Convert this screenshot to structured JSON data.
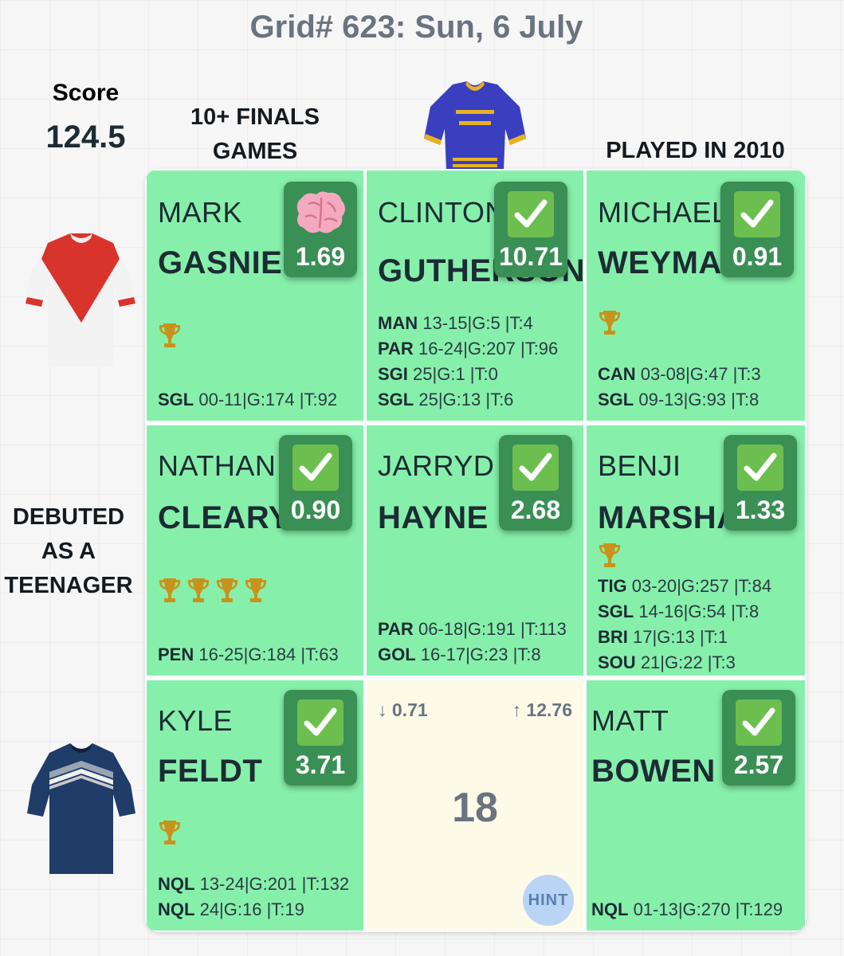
{
  "title": "Grid# 623: Sun, 6 July",
  "score": {
    "label": "Score",
    "value": "124.5"
  },
  "columns": [
    {
      "label_line1": "10+ FINALS",
      "label_line2": "GAMES"
    },
    {
      "jersey": "eels-jersey"
    },
    {
      "label_line1": "PLAYED IN 2010"
    }
  ],
  "rows": [
    {
      "jersey": "dragons-jersey"
    },
    {
      "label_line1": "DEBUTED",
      "label_line2": "AS A",
      "label_line3": "TEENAGER"
    },
    {
      "jersey": "cowboys-jersey"
    }
  ],
  "cells": {
    "r1c1": {
      "first": "MARK",
      "last": "GASNIER",
      "badge_icon": "brain-icon",
      "score": "1.69",
      "trophies": 1,
      "career": [
        {
          "team": "SGL",
          "detail": "00-11|G:174 |T:92"
        }
      ]
    },
    "r1c2": {
      "first": "CLINTON",
      "last": "GUTHERSON",
      "badge_icon": "check-icon",
      "score": "10.71",
      "trophies": 0,
      "career": [
        {
          "team": "MAN",
          "detail": "13-15|G:5 |T:4"
        },
        {
          "team": "PAR",
          "detail": "16-24|G:207 |T:96"
        },
        {
          "team": "SGI",
          "detail": "25|G:1 |T:0"
        },
        {
          "team": "SGL",
          "detail": "25|G:13 |T:6"
        }
      ]
    },
    "r1c3": {
      "first": "MICHAEL",
      "last": "WEYMAN",
      "badge_icon": "check-icon",
      "score": "0.91",
      "trophies": 1,
      "career": [
        {
          "team": "CAN",
          "detail": "03-08|G:47 |T:3"
        },
        {
          "team": "SGL",
          "detail": "09-13|G:93 |T:8"
        }
      ]
    },
    "r2c1": {
      "first": "NATHAN",
      "last": "CLEARY",
      "badge_icon": "check-icon",
      "score": "0.90",
      "trophies": 4,
      "career": [
        {
          "team": "PEN",
          "detail": "16-25|G:184 |T:63"
        }
      ]
    },
    "r2c2": {
      "first": "JARRYD",
      "last": "HAYNE",
      "badge_icon": "check-icon",
      "score": "2.68",
      "trophies": 0,
      "career": [
        {
          "team": "PAR",
          "detail": "06-18|G:191 |T:113"
        },
        {
          "team": "GOL",
          "detail": "16-17|G:23 |T:8"
        }
      ]
    },
    "r2c3": {
      "first": "BENJI",
      "last": "MARSHALL",
      "badge_icon": "check-icon",
      "score": "1.33",
      "trophies": 1,
      "career": [
        {
          "team": "TIG",
          "detail": "03-20|G:257 |T:84"
        },
        {
          "team": "SGL",
          "detail": "14-16|G:54 |T:8"
        },
        {
          "team": "BRI",
          "detail": "17|G:13 |T:1"
        },
        {
          "team": "SOU",
          "detail": "21|G:22 |T:3"
        }
      ]
    },
    "r3c1": {
      "first": "KYLE",
      "last": "FELDT",
      "badge_icon": "check-icon",
      "score": "3.71",
      "trophies": 1,
      "career": [
        {
          "team": "NQL",
          "detail": "13-24|G:201 |T:132"
        },
        {
          "team": "NQL",
          "detail": "24|G:16 |T:19"
        }
      ]
    },
    "r3c2": {
      "empty": true,
      "low": "↓ 0.71",
      "high": "↑ 12.76",
      "count": "18",
      "hint": "HINT"
    },
    "r3c3": {
      "first": "MATT",
      "last": "BOWEN",
      "badge_icon": "check-icon",
      "score": "2.57",
      "trophies": 0,
      "career": [
        {
          "team": "NQL",
          "detail": "01-13|G:270 |T:129"
        }
      ]
    }
  },
  "colors": {
    "correct_cell": "#86f0ab",
    "badge": "#3a8f55",
    "check": "#6cbf4f",
    "empty_cell": "#fdfbe8"
  }
}
